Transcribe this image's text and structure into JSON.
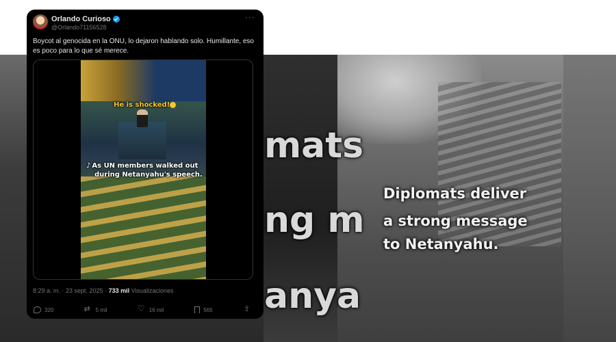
{
  "tweet": {
    "display_name": "Orlando Curioso",
    "handle": "@Orlando71156528",
    "more": "···",
    "text": "Boycot al genocida en la ONU, lo dejaron hablando solo. Humillante, eso es poco para lo que sé merece.",
    "timestamp": "8:29 a. m. · 23 sept. 2025 · ",
    "views_count": "733 mil",
    "views_label": " Visualizaciones",
    "replies": "320",
    "retweets": "5 mil",
    "likes": "16 mil",
    "bookmarks": "565"
  },
  "video": {
    "overlay_1": "He is shocked!",
    "overlay_2_line1": "As UN members walked out",
    "overlay_2_line2": "during Netanyahu's speech."
  },
  "background": {
    "big_1": "mats",
    "big_2": "ng m",
    "big_3": "anya",
    "caption_1": "Diplomats deliver",
    "caption_2": "a strong message",
    "caption_3": "to Netanyahu."
  },
  "colors": {
    "card_bg": "#000000",
    "accent_verified": "#1d9bf0",
    "text_primary": "#e7e9ea",
    "text_secondary": "#71767b"
  },
  "icons": [
    "verified-icon",
    "more-icon",
    "reply-icon",
    "retweet-icon",
    "like-icon",
    "bookmark-icon",
    "share-icon",
    "tiktok-icon"
  ]
}
